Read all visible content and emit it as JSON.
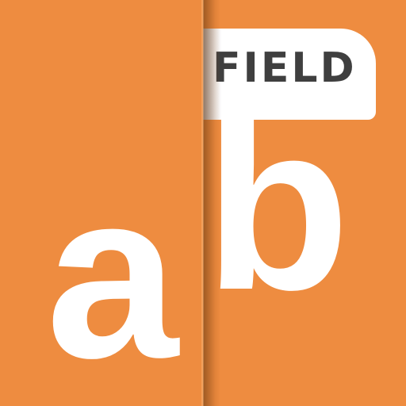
{
  "app_icon": {
    "badge_label": "FIELD",
    "letter_left": "a",
    "letter_right": "b",
    "colors": {
      "background": "#ee8c40",
      "badge_background": "#ffffff",
      "badge_text": "#3f3f3f",
      "letters": "#ffffff"
    }
  }
}
